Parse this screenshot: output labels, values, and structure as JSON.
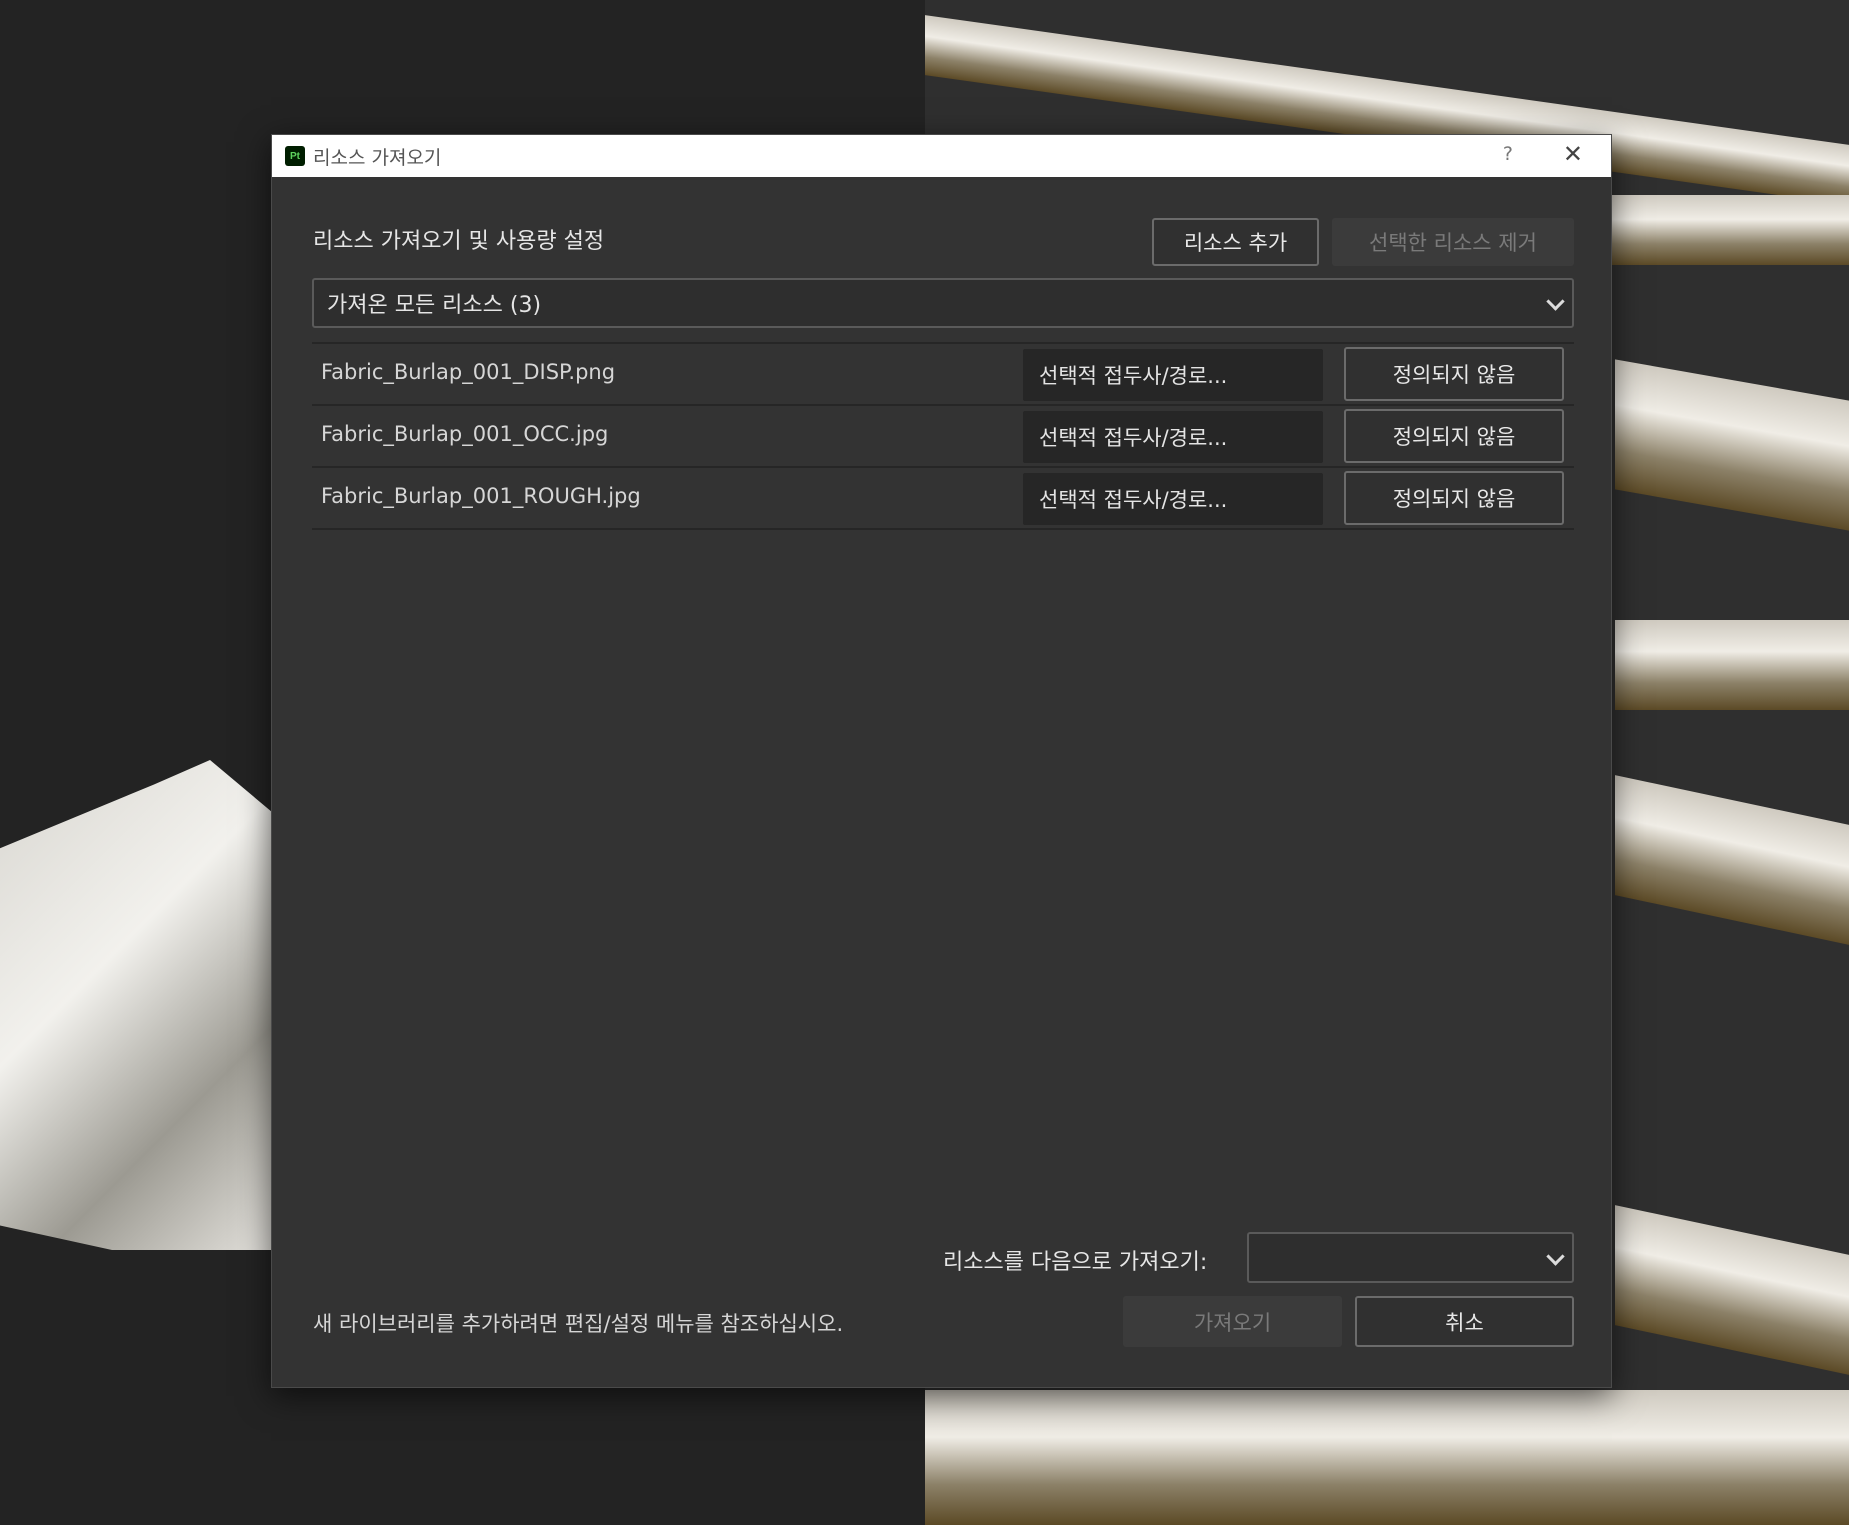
{
  "dialog": {
    "title": "리소스 가져오기",
    "app_icon_text": "Pt",
    "help_label": "?",
    "close_label": "✕"
  },
  "header": {
    "heading": "리소스 가져오기 및 사용량 설정",
    "add_button": "리소스 추가",
    "remove_button": "선택한 리소스 제거"
  },
  "filter": {
    "selected": "가져온 모든 리소스 (3)"
  },
  "resources": [
    {
      "name": "Fabric_Burlap_001_DISP.png",
      "prefix": "선택적 접두사/경로...",
      "usage": "정의되지 않음"
    },
    {
      "name": "Fabric_Burlap_001_OCC.jpg",
      "prefix": "선택적 접두사/경로...",
      "usage": "정의되지 않음"
    },
    {
      "name": "Fabric_Burlap_001_ROUGH.jpg",
      "prefix": "선택적 접두사/경로...",
      "usage": "정의되지 않음"
    }
  ],
  "footer": {
    "import_to_label": "리소스를 다음으로 가져오기:",
    "import_to_value": "",
    "hint": "새 라이브러리를 추가하려면 편집/설정 메뉴를 참조하십시오.",
    "import_button": "가져오기",
    "cancel_button": "취소"
  }
}
